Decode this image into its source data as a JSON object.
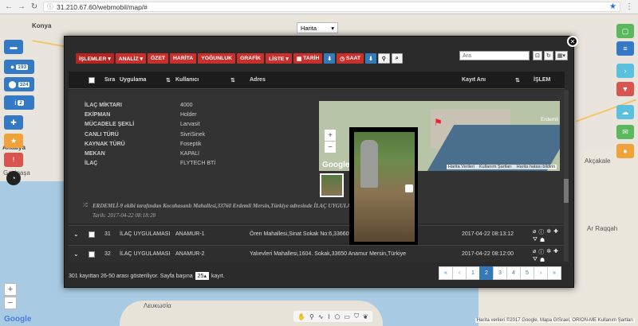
{
  "browser": {
    "url": "31.210.67.60/webmobil/map/#"
  },
  "map": {
    "type_select": "Harita",
    "labels": [
      "Konya",
      "Antalya",
      "Gazipaşa",
      "Erdemli",
      "Akçakale",
      "Ar Raqqah",
      "Λευκωσία"
    ],
    "credit": "Harita verileri ©2017 Google, Mapa GISrael, ORION-ME",
    "terms": "Kullanım Şartları"
  },
  "left_buttons": [
    {
      "icon": "bus-icon",
      "count": ""
    },
    {
      "icon": "user-icon",
      "count": "193"
    },
    {
      "icon": "marker-icon",
      "count": "324"
    },
    {
      "icon": "info-icon",
      "count": "2"
    },
    {
      "icon": "crosshair-icon",
      "count": ""
    },
    {
      "icon": "star-icon",
      "count": ""
    },
    {
      "icon": "alert-icon",
      "count": ""
    },
    {
      "icon": "gauge-icon",
      "count": ""
    }
  ],
  "toolbar": {
    "islemler": "İŞLEMLER ▾",
    "analiz": "ANALİZ ▾",
    "ozet": "ÖZET",
    "harita": "HARİTA",
    "yogunluk": "YOĞUNLUK",
    "grafik": "GRAFİK",
    "liste": "LİSTE ▾",
    "tarih": "TARİH",
    "saat": "SAAT",
    "search_placeholder": "Ara"
  },
  "table": {
    "headers": {
      "sira": "Sıra",
      "uygulama": "Uygulama",
      "kullanici": "Kullanıcı",
      "adres": "Adres",
      "kayit": "Kayıt Anı",
      "islem": "İŞLEM"
    }
  },
  "detail": {
    "rows": [
      {
        "k": "İLAÇ MİKTARI",
        "v": "4000"
      },
      {
        "k": "EKİPMAN",
        "v": "Holder"
      },
      {
        "k": "MÜCADELE ŞEKLİ",
        "v": "Larvasit"
      },
      {
        "k": "CANLI TÜRÜ",
        "v": "SivriSinek"
      },
      {
        "k": "KAYNAK TÜRÜ",
        "v": "Foseptik"
      },
      {
        "k": "MEKAN",
        "v": "KAPALI"
      },
      {
        "k": "İLAÇ",
        "v": "FLYTECH BTİ"
      }
    ],
    "map_town": "Erdemli",
    "map_footer": [
      "Harita Verileri",
      "Kullanım Şartları",
      "Harita hatası bildirin"
    ],
    "log_text": "ERDEMLİ-9 ekibi tarafından Kocahasanlı Mahallesi,33760 Erdemli Mersin,Türkiye adresinde İLAÇ UYGULA",
    "log_date": "Tarih: 2017-04-22 08:18:28"
  },
  "rows": [
    {
      "sira": "31",
      "uygulama": "İLAÇ UYGULAMASI",
      "kullanici": "ANAMUR-1",
      "adres": "Ören Mahallesi,Sinat Sokak No:6,33660 An",
      "kayit": "2017-04-22 08:13:12"
    },
    {
      "sira": "32",
      "uygulama": "İLAÇ UYGULAMASI",
      "kullanici": "ANAMUR-2",
      "adres": "Yalıevleri Mahallesi,1604. Sokak,33650 Anamur Mersin,Türkiye",
      "kayit": "2017-04-22 08:12:00"
    }
  ],
  "footer": {
    "info": "301 kayıttan 26-50 arası gösteriliyor. Sayfa başına",
    "page_size": "25",
    "suffix": "kayıt."
  },
  "pagination": [
    "«",
    "‹",
    "1",
    "2",
    "3",
    "4",
    "5",
    "›",
    "»"
  ],
  "pagination_active": "2",
  "colors": {
    "accent_red": "#c9302c",
    "accent_blue": "#337ab7",
    "modal_bg": "#2b2b2b"
  }
}
